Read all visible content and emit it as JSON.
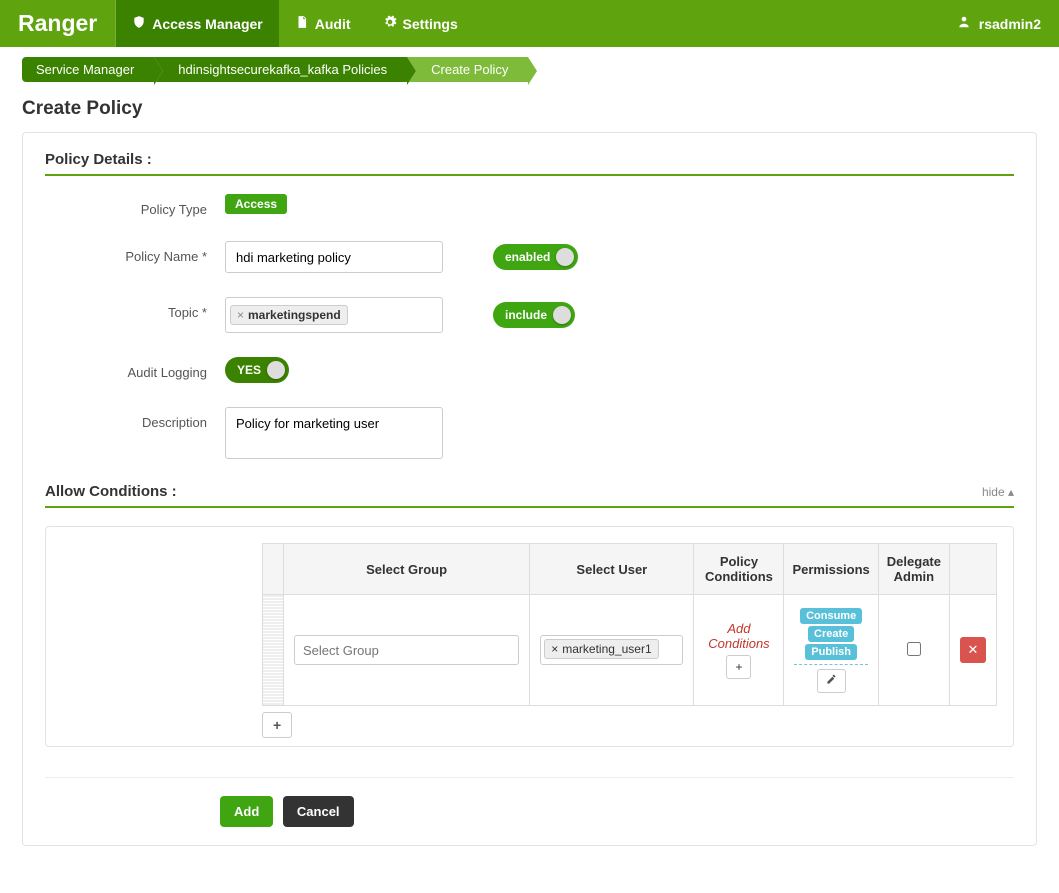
{
  "brand": "Ranger",
  "nav": {
    "access": "Access Manager",
    "audit": "Audit",
    "settings": "Settings"
  },
  "user": "rsadmin2",
  "breadcrumbs": [
    "Service Manager",
    "hdinsightsecurekafka_kafka Policies",
    "Create Policy"
  ],
  "page_title": "Create Policy",
  "sections": {
    "details_title": "Policy Details :",
    "allow_title": "Allow Conditions :",
    "hide": "hide"
  },
  "labels": {
    "policy_type": "Policy Type",
    "policy_name": "Policy Name *",
    "topic": "Topic *",
    "audit_logging": "Audit Logging",
    "description": "Description"
  },
  "values": {
    "policy_type_badge": "Access",
    "policy_name": "hdi marketing policy",
    "topic_tag": "marketingspend",
    "enabled_toggle": "enabled",
    "include_toggle": "include",
    "audit_toggle": "YES",
    "description": "Policy for marketing user"
  },
  "table": {
    "headers": {
      "group": "Select Group",
      "user": "Select User",
      "conditions": "Policy Conditions",
      "permissions": "Permissions",
      "delegate": "Delegate Admin"
    },
    "row": {
      "group_placeholder": "Select Group",
      "user_token": "marketing_user1",
      "add_conditions": "Add Conditions",
      "permissions": [
        "Consume",
        "Create",
        "Publish"
      ]
    }
  },
  "buttons": {
    "add": "Add",
    "cancel": "Cancel",
    "plus": "+"
  }
}
